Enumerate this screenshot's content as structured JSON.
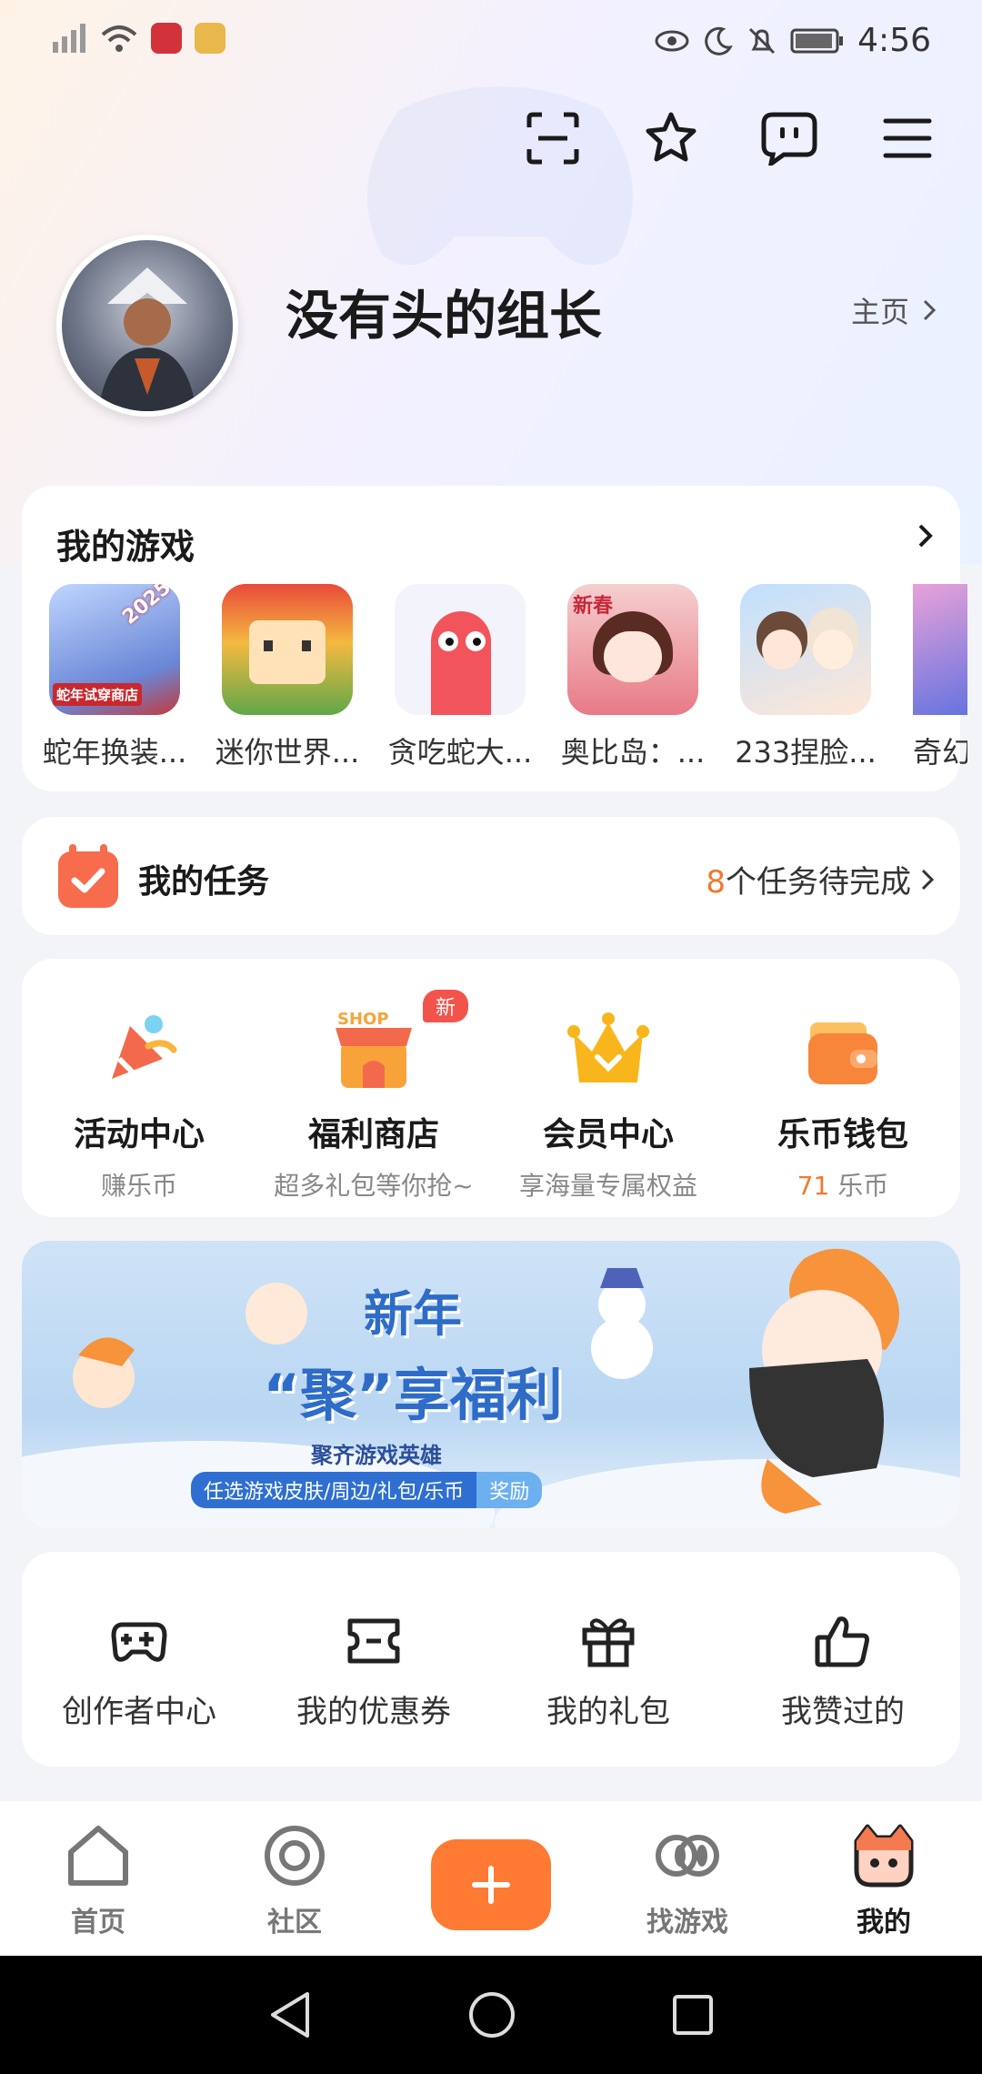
{
  "status_bar": {
    "time": "4:56"
  },
  "profile": {
    "username": "没有头的组长",
    "homepage_label": "主页"
  },
  "my_games": {
    "title": "我的游戏",
    "items": [
      {
        "name": "蛇年换装...",
        "badge": "2025",
        "caption": "蛇年试穿商店"
      },
      {
        "name": "迷你世界..."
      },
      {
        "name": "贪吃蛇大..."
      },
      {
        "name": "奥比岛：...",
        "badge": "新春"
      },
      {
        "name": "233捏脸..."
      },
      {
        "name": "奇幻"
      }
    ]
  },
  "tasks": {
    "title": "我的任务",
    "count": "8",
    "count_suffix": "个任务待完成"
  },
  "features": [
    {
      "title": "活动中心",
      "subtitle": "赚乐币"
    },
    {
      "title": "福利商店",
      "subtitle": "超多礼包等你抢~",
      "badge": "新",
      "sign": "SHOP"
    },
    {
      "title": "会员中心",
      "subtitle": "享海量专属权益"
    },
    {
      "title": "乐币钱包",
      "subtitle_value": "71",
      "subtitle_unit": "乐币"
    }
  ],
  "banner": {
    "headline_1": "新年",
    "headline_2": "“聚”享福利",
    "subtitle": "聚齐游戏英雄",
    "tagline": "任选游戏皮肤/周边/礼包/乐币",
    "tagline_end": "奖励"
  },
  "tools": [
    {
      "label": "创作者中心",
      "icon": "gamepad-plus-icon"
    },
    {
      "label": "我的优惠券",
      "icon": "ticket-icon"
    },
    {
      "label": "我的礼包",
      "icon": "gift-icon"
    },
    {
      "label": "我赞过的",
      "icon": "thumbs-up-icon"
    }
  ],
  "bottom_nav": [
    {
      "label": "首页"
    },
    {
      "label": "社区"
    },
    {
      "label": ""
    },
    {
      "label": "找游戏"
    },
    {
      "label": "我的"
    }
  ],
  "colors": {
    "accent": "#ff7a32",
    "highlight": "#f07a2e",
    "badge_red": "#f2544b"
  }
}
